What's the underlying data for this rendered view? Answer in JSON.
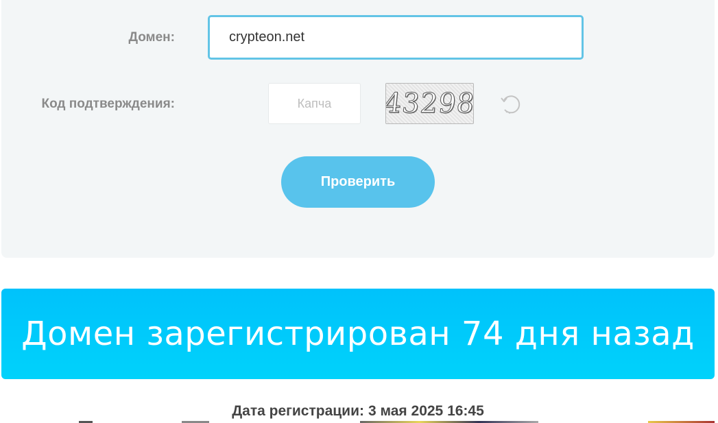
{
  "form": {
    "domain_label": "Домен:",
    "domain_value": "crypteon.net",
    "captcha_label": "Код подтверждения:",
    "captcha_placeholder": "Капча",
    "captcha_code": "43298",
    "refresh_icon": "refresh-icon",
    "submit_label": "Проверить"
  },
  "result": {
    "headline": "Домен зарегистрирован 74 дня назад",
    "reg_date_label": "Дата регистрации:",
    "reg_date_value": "3 мая 2025 16:45"
  },
  "colors": {
    "panel_bg": "#f3f6f7",
    "input_border": "#62c4e6",
    "button": "#58c3ec",
    "banner": "#00c8fb"
  }
}
